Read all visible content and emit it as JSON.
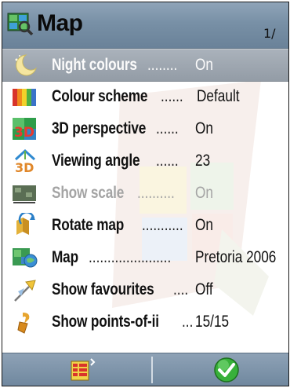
{
  "header": {
    "title": "Map",
    "page_indicator": "1/",
    "icon": "map-settings-icon"
  },
  "settings": [
    {
      "label": "Night colours",
      "dots": " ........",
      "value": "On",
      "icon": "moon-icon",
      "selected": true,
      "disabled": false
    },
    {
      "label": "Colour scheme",
      "dots": " ......",
      "value": "Default",
      "icon": "colour-bars-icon",
      "selected": false,
      "disabled": false
    },
    {
      "label": "3D perspective",
      "dots": " ......",
      "value": "On",
      "icon": "3d-icon",
      "selected": false,
      "disabled": false
    },
    {
      "label": "Viewing angle",
      "dots": " ......",
      "value": "23",
      "icon": "angle-3d-icon",
      "selected": false,
      "disabled": false
    },
    {
      "label": "Show scale",
      "dots": " ..........",
      "value": "On",
      "icon": "scale-icon",
      "selected": false,
      "disabled": true
    },
    {
      "label": "Rotate map",
      "dots": " ...........",
      "value": "On",
      "icon": "rotate-map-icon",
      "selected": false,
      "disabled": false
    },
    {
      "label": "Map",
      "dots": " ......................",
      "value": "Pretoria 2006",
      "icon": "map-globe-icon",
      "selected": false,
      "disabled": false
    },
    {
      "label": "Show favourites",
      "dots": " ....",
      "value": "Off",
      "icon": "favourites-pin-icon",
      "selected": false,
      "disabled": false
    },
    {
      "label": "Show points-of-ii",
      "dots": "...",
      "value": "15/15",
      "icon": "poi-icon",
      "selected": false,
      "disabled": false
    }
  ],
  "softkeys": {
    "left_icon": "options-menu-icon",
    "right_icon": "confirm-check-icon"
  },
  "colors": {
    "titlebar": "#7890a6",
    "selected_row": "#9aa2ab",
    "softbar": "#7a90a6",
    "disabled_text": "#a4a4a4",
    "check_green": "#2fa82f"
  }
}
